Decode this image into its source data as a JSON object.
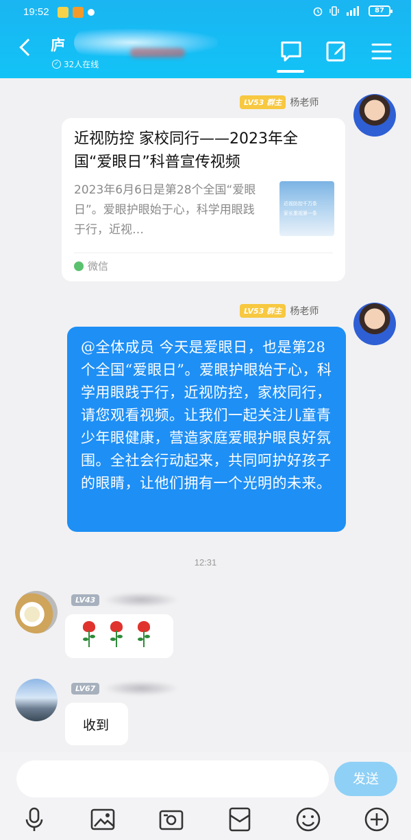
{
  "status_bar": {
    "time": "19:52",
    "battery": "87"
  },
  "header": {
    "title": "庐",
    "online_count": "32人在线",
    "colors": {
      "bar": "#1ab5f2",
      "accent": "#1e8ff5"
    }
  },
  "messages": {
    "card_msg": {
      "level": "LV53",
      "role": "群主",
      "sender": "杨老师",
      "title": "近视防控 家校同行——2023年全国“爱眼日”科普宣传视频",
      "desc": "2023年6月6日是第28个全国“爱眼日”。爱眼护眼始于心，科学用眼践于行，近视…",
      "thumb_line1": "近视防控千万条",
      "thumb_line2": "家长重视第一条",
      "source": "微信"
    },
    "text_msg": {
      "level": "LV53",
      "role": "群主",
      "sender": "杨老师",
      "text": "@全体成员 今天是爱眼日，也是第28个全国“爱眼日”。爱眼护眼始于心，科学用眼践于行，近视防控，家校同行，请您观看视频。让我们一起关注儿童青少年眼健康，营造家庭爱眼护眼良好氛围。全社会行动起来，共同呵护好孩子的眼睛，让他们拥有一个光明的未来。"
    },
    "timestamp": "12:31",
    "roses_msg": {
      "level": "LV43"
    },
    "received_msg": {
      "level": "LV67",
      "text": "收到"
    }
  },
  "input": {
    "placeholder": "",
    "send_label": "发送"
  },
  "toolbar": {
    "icons": [
      "microphone-icon",
      "image-icon",
      "camera-icon",
      "red-packet-icon",
      "emoji-icon",
      "plus-icon"
    ]
  }
}
